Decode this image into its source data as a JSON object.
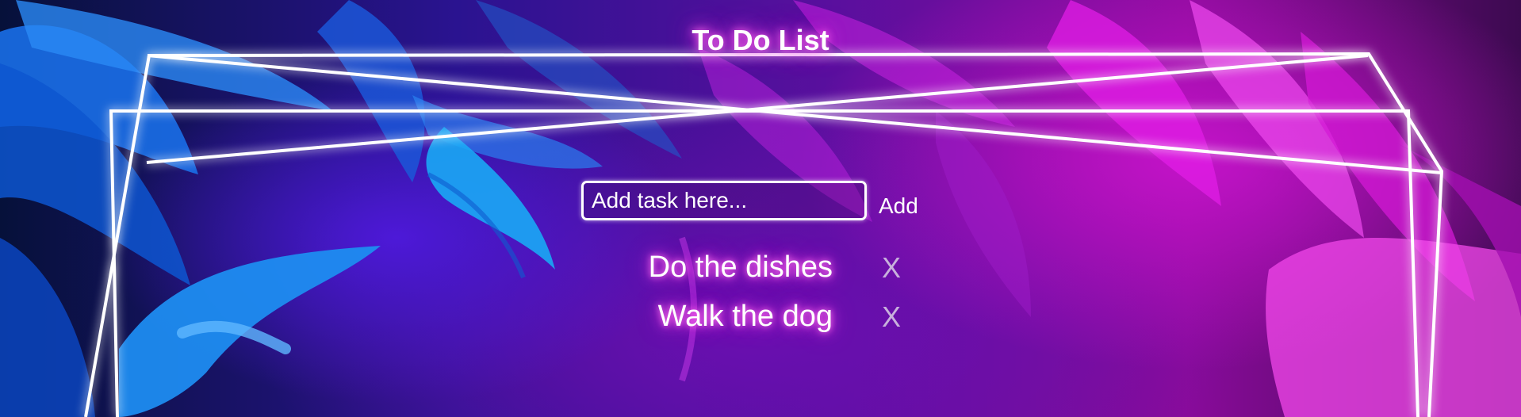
{
  "app": {
    "title": "To Do List"
  },
  "colors": {
    "neon_frame": "#ffffff",
    "glow_pink": "#ff3fe6",
    "accent_blue": "#1e90ff",
    "accent_magenta": "#e21ee8",
    "remove_text": "#c8b0dc"
  },
  "form": {
    "input_placeholder": "Add task here...",
    "input_value": "",
    "add_label": "Add"
  },
  "tasks": [
    {
      "text": "Do the dishes",
      "remove_label": "X"
    },
    {
      "text": "Walk the dog",
      "remove_label": "X"
    }
  ]
}
